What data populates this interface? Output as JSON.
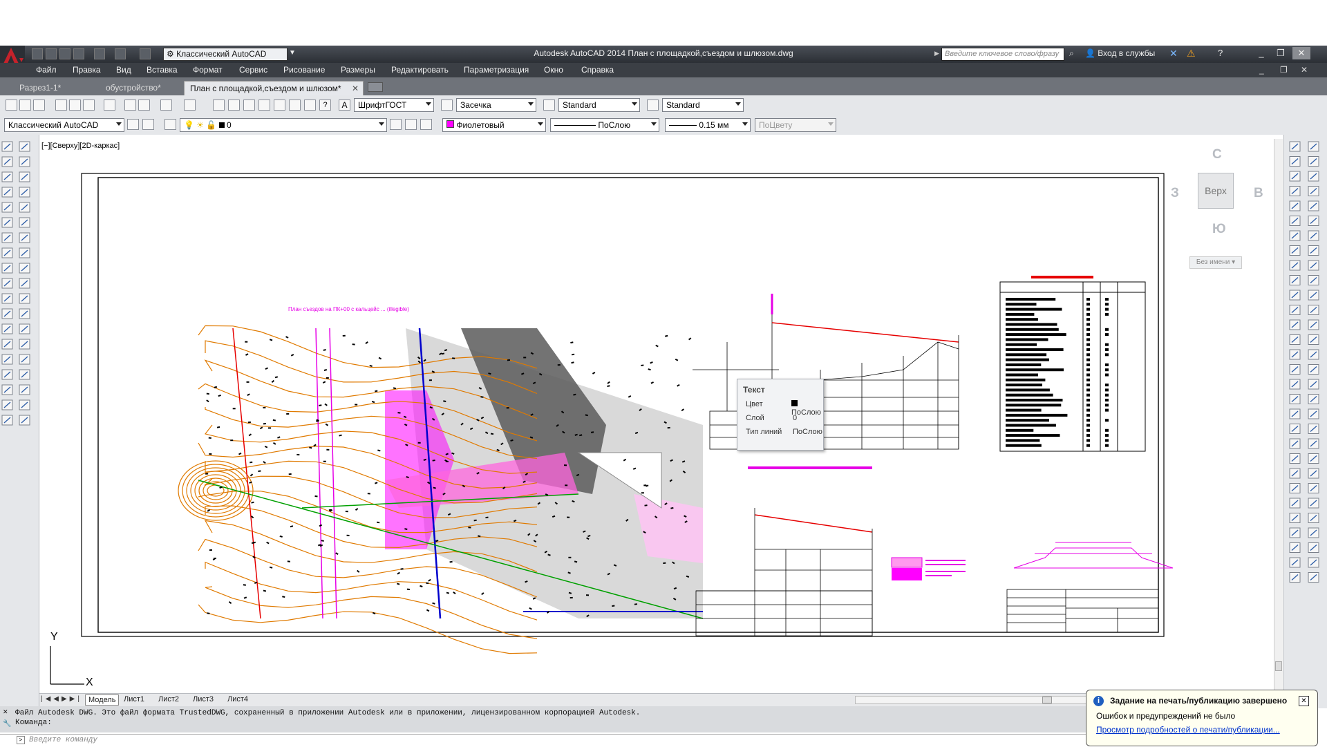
{
  "app": {
    "title": "Autodesk AutoCAD 2014    План с площадкой,съездом и шлюзом.dwg",
    "workspace": "Классический AutoCAD",
    "search_placeholder": "Введите ключевое слово/фразу",
    "login": "Вход в службы",
    "accent_color": "#c5222b"
  },
  "menu": [
    "Файл",
    "Правка",
    "Вид",
    "Вставка",
    "Формат",
    "Сервис",
    "Рисование",
    "Размеры",
    "Редактировать",
    "Параметризация",
    "Окно",
    "Справка"
  ],
  "file_tabs": [
    {
      "label": "Разрез1-1*",
      "active": false
    },
    {
      "label": "обустройство*",
      "active": false
    },
    {
      "label": "План с площадкой,съездом и шлюзом*",
      "active": true
    }
  ],
  "styles_toolbar": {
    "text_style": "ШрифтГОСТ",
    "dim_style": "Засечка",
    "table_style": "Standard",
    "mleader_style": "Standard"
  },
  "layers_toolbar": {
    "workspace": "Классический AutoCAD",
    "current_layer": "0",
    "color": "Фиолетовый",
    "color_hex": "#ff00ff",
    "linetype": "ПоСлою",
    "lineweight": "0.15 мм",
    "plot_style": "ПоЦвету"
  },
  "viewport_label": "[−][Сверху][2D-каркас]",
  "viewcube": {
    "north": "С",
    "south": "Ю",
    "west": "З",
    "east": "В",
    "face": "Верх",
    "ucs": "Без имени"
  },
  "ucs_icon": {
    "x": "X",
    "y": "Y"
  },
  "drawing": {
    "plan_title": "План съездов на ПК+00 с кальцейс ... (illegible)"
  },
  "tooltip": {
    "title": "Текст",
    "rows": [
      {
        "label": "Цвет",
        "value": "ПоСлою"
      },
      {
        "label": "Слой",
        "value": "0"
      },
      {
        "label": "Тип линий",
        "value": "ПоСлою"
      }
    ]
  },
  "layout_tabs": [
    {
      "label": "Модель",
      "active": true
    },
    {
      "label": "Лист1",
      "active": false
    },
    {
      "label": "Лист2",
      "active": false
    },
    {
      "label": "Лист3",
      "active": false
    },
    {
      "label": "Лист4",
      "active": false
    }
  ],
  "command": {
    "history": [
      "Файл Autodesk DWG. Это файл формата TrustedDWG, сохраненный в приложении Autodesk или в приложении, лицензированном корпорацией Autodesk.",
      "Команда:"
    ],
    "placeholder": "Введите команду"
  },
  "notification": {
    "title": "Задание на печать/публикацию завершено",
    "message": "Ошибок и предупреждений не было",
    "link": "Просмотр подробностей о печати/публикации..."
  }
}
